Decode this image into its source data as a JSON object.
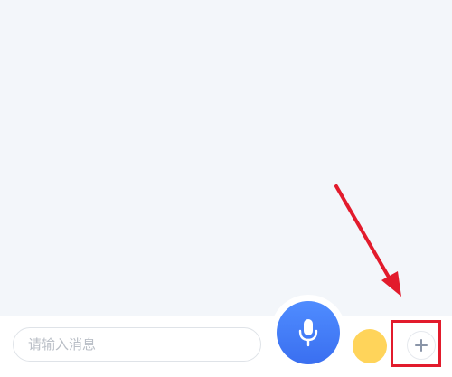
{
  "composer": {
    "placeholder": "请输入消息"
  },
  "icons": {
    "mic": "microphone-icon",
    "emoji": "emoji-icon",
    "plus": "plus-icon",
    "annotation": "red-arrow"
  },
  "colors": {
    "background": "#f3f6fa",
    "mic_button": "#3f78f5",
    "emoji_button": "#ffd45a",
    "annotation": "#e21b2c"
  }
}
